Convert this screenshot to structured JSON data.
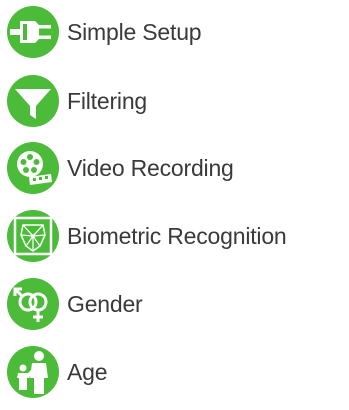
{
  "features": [
    {
      "label": "Simple Setup",
      "icon": "plug-icon",
      "color": "#4cbb3a"
    },
    {
      "label": "Filtering",
      "icon": "funnel-icon",
      "color": "#4cbb3a"
    },
    {
      "label": "Video Recording",
      "icon": "film-reel-icon",
      "color": "#4cbb3a"
    },
    {
      "label": "Biometric Recognition",
      "icon": "face-mesh-icon",
      "color": "#4cbb3a"
    },
    {
      "label": "Gender",
      "icon": "gender-symbols-icon",
      "color": "#4cbb3a"
    },
    {
      "label": "Age",
      "icon": "parent-child-icon",
      "color": "#4cbb3a"
    }
  ]
}
